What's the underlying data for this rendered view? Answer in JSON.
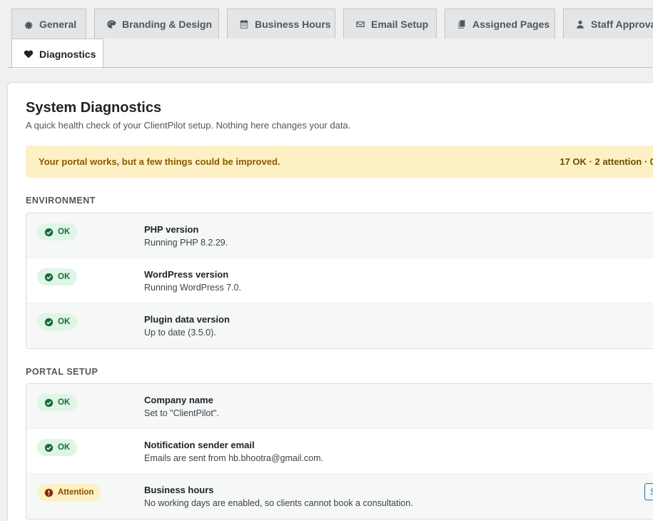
{
  "tabs": [
    {
      "label": "General",
      "icon": "gear-icon"
    },
    {
      "label": "Branding & Design",
      "icon": "palette-icon"
    },
    {
      "label": "Business Hours",
      "icon": "calendar-icon"
    },
    {
      "label": "Email Setup",
      "icon": "envelope-icon"
    },
    {
      "label": "Assigned Pages",
      "icon": "pages-icon"
    },
    {
      "label": "Staff Approva",
      "icon": "user-icon"
    },
    {
      "label": "Diagnostics",
      "icon": "heart-icon",
      "active": true
    }
  ],
  "page": {
    "title": "System Diagnostics",
    "subtitle": "A quick health check of your ClientPilot setup. Nothing here changes your data."
  },
  "banner": {
    "message": "Your portal works, but a few things could be improved.",
    "counts": "17 OK · 2 attention · 0"
  },
  "sections": {
    "environment": {
      "label": "ENVIRONMENT",
      "rows": [
        {
          "status": "OK",
          "title": "PHP version",
          "desc": "Running PHP 8.2.29."
        },
        {
          "status": "OK",
          "title": "WordPress version",
          "desc": "Running WordPress 7.0."
        },
        {
          "status": "OK",
          "title": "Plugin data version",
          "desc": "Up to date (3.5.0)."
        }
      ]
    },
    "portal": {
      "label": "PORTAL SETUP",
      "rows": [
        {
          "status": "OK",
          "title": "Company name",
          "desc": "Set to \"ClientPilot\"."
        },
        {
          "status": "OK",
          "title": "Notification sender email",
          "desc": "Emails are sent from hb.bhootra@gmail.com."
        },
        {
          "status": "Attention",
          "title": "Business hours",
          "desc": "No working days are enabled, so clients cannot book a consultation.",
          "action": "S"
        }
      ]
    }
  },
  "colors": {
    "ok_bg": "#dff5e6",
    "ok_fg": "#1a6b39",
    "attention_bg": "#fdf0c4",
    "attention_fg": "#8a4b00",
    "accent": "#2271b1"
  }
}
